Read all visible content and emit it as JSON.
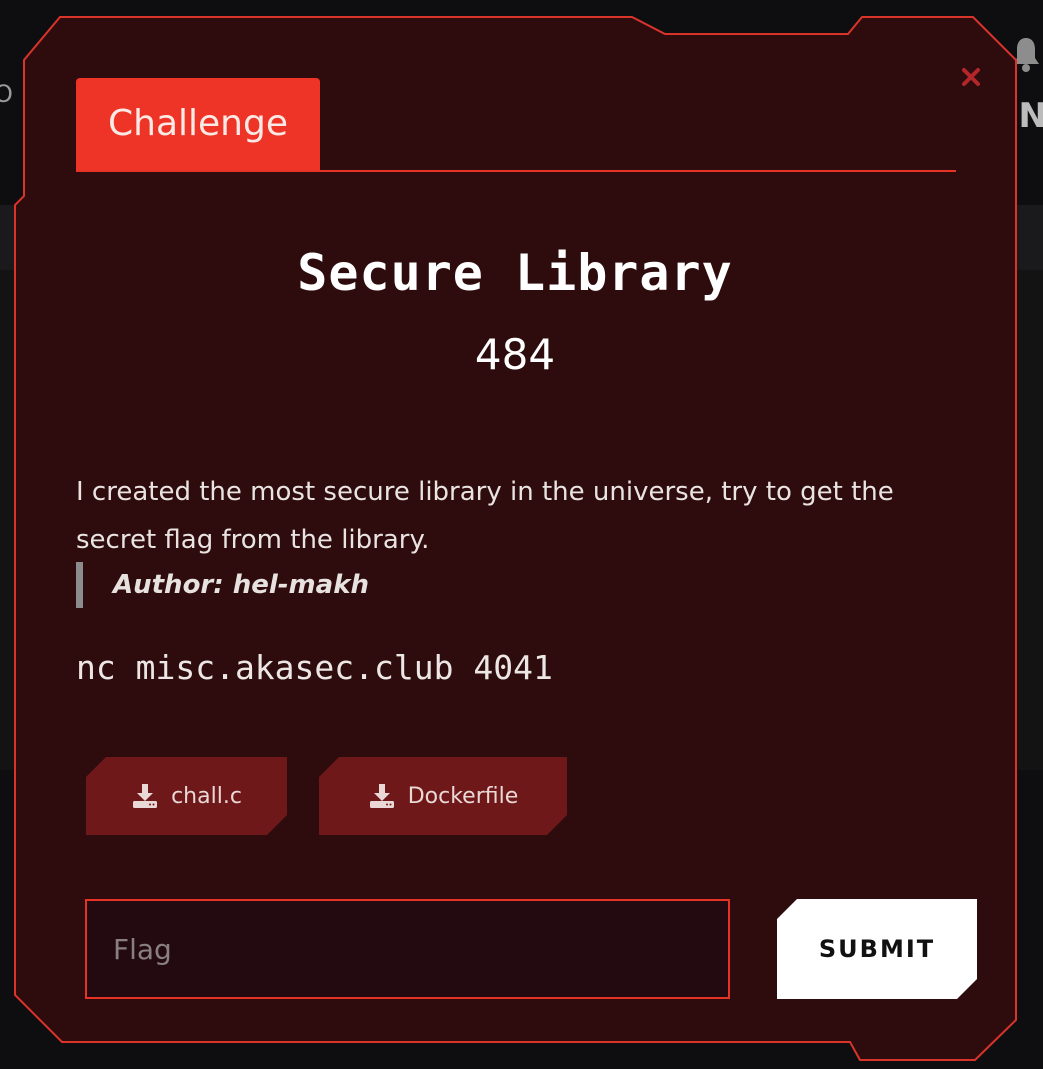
{
  "background": {
    "right_letter": "N",
    "left_letter": "O"
  },
  "modal": {
    "close_icon": "close-x-icon",
    "tab_label": "Challenge",
    "title": "Secure Library",
    "points": "484",
    "description": "I created the most secure library in the universe, try to get the secret flag from the library.",
    "author": "Author: hel-makh",
    "connection": "nc misc.akasec.club 4041",
    "files": [
      {
        "label": "chall.c",
        "icon": "download-icon"
      },
      {
        "label": "Dockerfile",
        "icon": "download-icon"
      }
    ],
    "flag_placeholder": "Flag",
    "submit_label": "SUBMIT"
  },
  "colors": {
    "accent": "#ee3426",
    "modal_bg": "#2e0c0d",
    "file_button_bg": "#6e1819",
    "input_bg": "#220a10",
    "submit_bg": "#ffffff"
  }
}
